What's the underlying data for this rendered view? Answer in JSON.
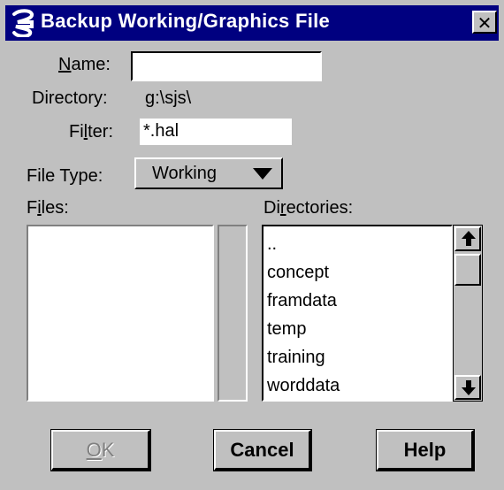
{
  "dialog": {
    "title": "Backup Working/Graphics File",
    "close_glyph": "✕"
  },
  "form": {
    "name_label_prefix": "",
    "name_label_key": "N",
    "name_label_rest": "ame:",
    "name_value": "",
    "directory_label": "Directory:",
    "directory_value": "g:\\sjs\\",
    "filter_label_pre": "Fi",
    "filter_label_key": "l",
    "filter_label_rest": "ter:",
    "filter_value": "*.hal",
    "filetype_label": "File Type:",
    "filetype_value": "Working",
    "files_label_pre": "F",
    "files_label_key": "i",
    "files_label_rest": "les:",
    "dirs_label_pre": "Di",
    "dirs_label_key": "r",
    "dirs_label_rest": "ectories:"
  },
  "files": [],
  "directories": [
    "..",
    "concept",
    "framdata",
    "temp",
    "training",
    "worddata"
  ],
  "buttons": {
    "ok_key": "O",
    "ok_rest": "K",
    "cancel": "Cancel",
    "help": "Help"
  },
  "icons": {
    "app": "app-logo-icon",
    "close": "close-icon",
    "dropdown": "triangle-down-icon",
    "scroll_up": "arrow-up-icon",
    "scroll_down": "arrow-down-icon"
  },
  "colors": {
    "titlebar": "#000080",
    "face": "#c0c0c0",
    "field": "#ffffff"
  }
}
